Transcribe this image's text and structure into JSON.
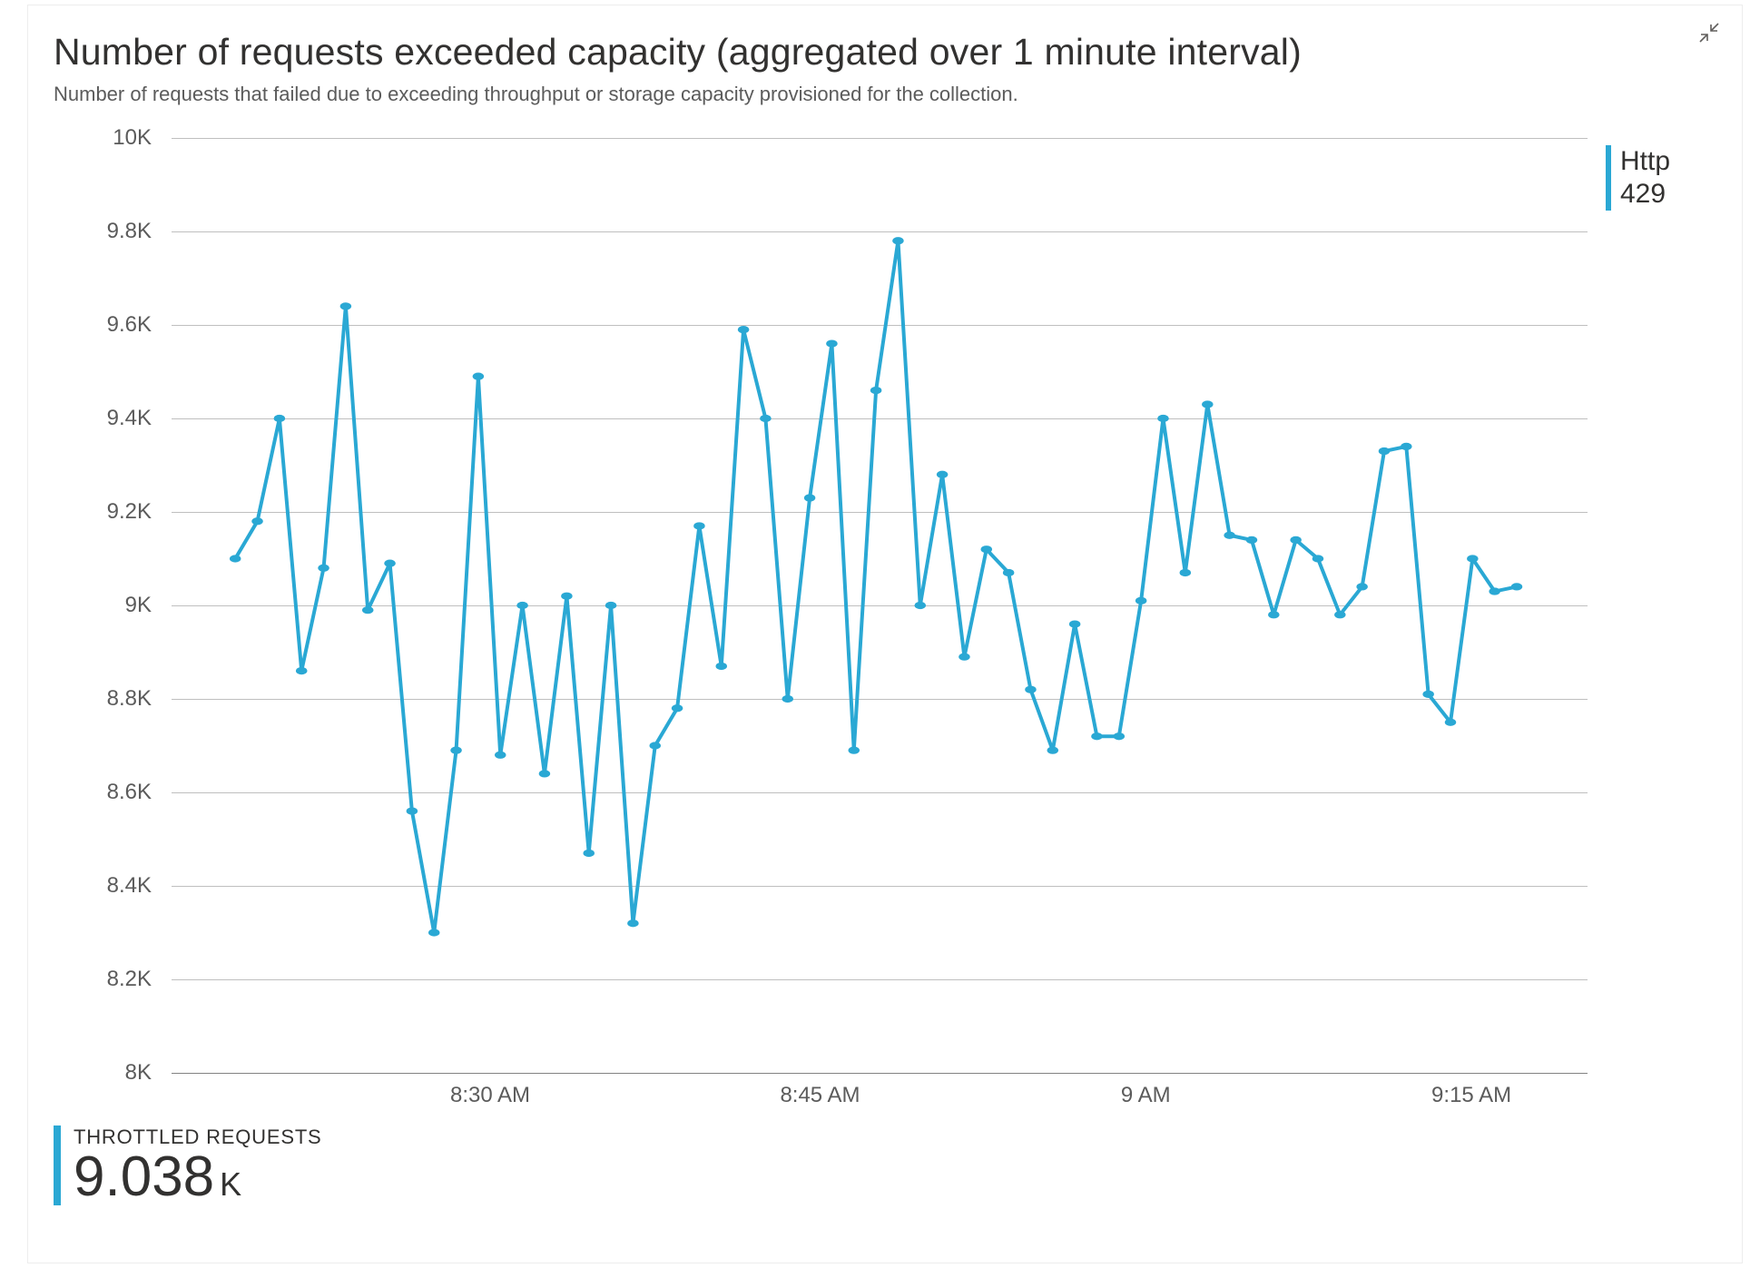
{
  "panel": {
    "title": "Number of requests exceeded capacity (aggregated over 1 minute interval)",
    "subtitle": "Number of requests that failed due to exceeding throughput or storage capacity provisioned for the collection."
  },
  "legend": {
    "series_label": "Http 429",
    "series_color": "#2aa8d4"
  },
  "metric": {
    "label": "THROTTLED REQUESTS",
    "value": "9.038",
    "unit": "K"
  },
  "chart_data": {
    "type": "line",
    "title": "Number of requests exceeded capacity (aggregated over 1 minute interval)",
    "xlabel": "",
    "ylabel": "",
    "ylim": [
      8000,
      10000
    ],
    "y_ticks": [
      8000,
      8200,
      8400,
      8600,
      8800,
      9000,
      9200,
      9400,
      9600,
      9800,
      10000
    ],
    "y_tick_labels": [
      "8K",
      "8.2K",
      "8.4K",
      "8.6K",
      "8.8K",
      "9K",
      "9.2K",
      "9.4K",
      "9.6K",
      "9.8K",
      "10K"
    ],
    "x_tick_labels": [
      "8:30 AM",
      "8:45 AM",
      "9 AM",
      "9:15 AM"
    ],
    "x_tick_positions_pct": [
      22.5,
      45.8,
      68.8,
      91.8
    ],
    "series": [
      {
        "name": "Http 429",
        "color": "#2aa8d4",
        "values": [
          9100,
          9180,
          9400,
          8860,
          9080,
          9640,
          8990,
          9090,
          8560,
          8300,
          8690,
          9490,
          8680,
          9000,
          8640,
          9020,
          8470,
          9000,
          8320,
          8700,
          8780,
          9170,
          8870,
          9590,
          9400,
          8800,
          9230,
          9560,
          8690,
          9460,
          9780,
          9000,
          9280,
          8890,
          9120,
          9070,
          8820,
          8690,
          8960,
          8720,
          8720,
          9010,
          9400,
          9070,
          9430,
          9150,
          9140,
          8980,
          9140,
          9100,
          8980,
          9040,
          9330,
          9340,
          8810,
          8750,
          9100,
          9030,
          9040
        ]
      }
    ]
  }
}
